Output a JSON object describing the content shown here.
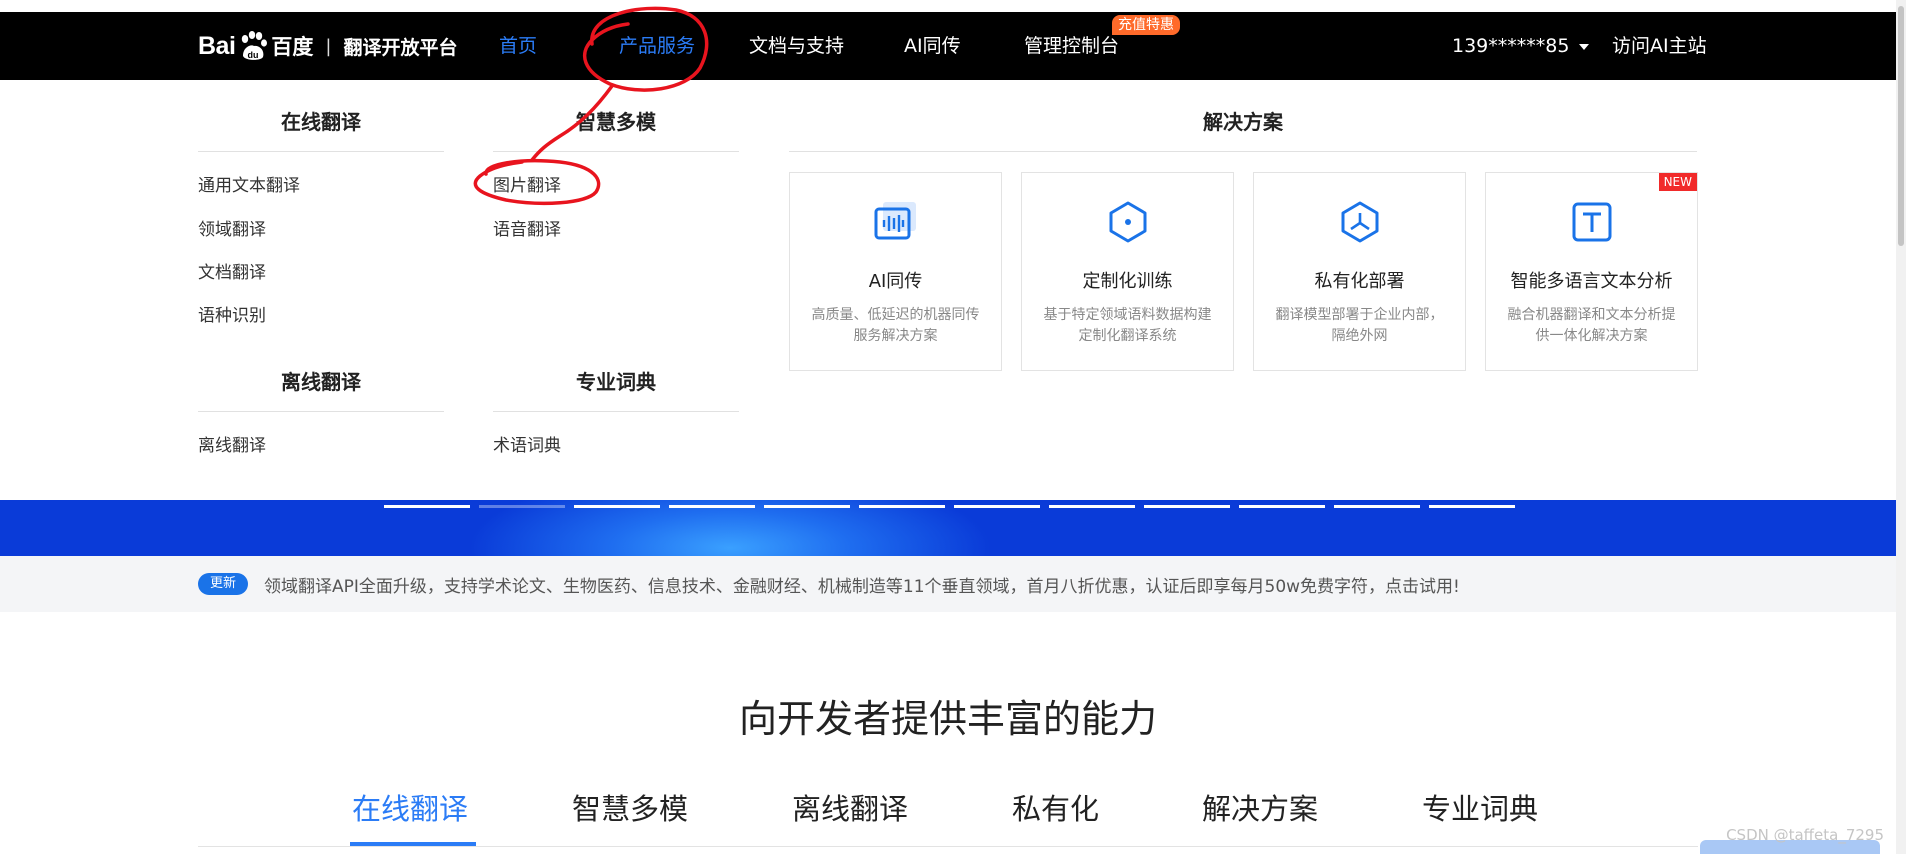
{
  "header": {
    "logo": {
      "bai": "Bai",
      "du": "百度",
      "separator": "|",
      "platform": "翻译开放平台"
    },
    "nav": {
      "home": "首页",
      "products": "产品服务",
      "docs": "文档与支持",
      "ai_simultaneous": "AI同传",
      "console": "管理控制台",
      "console_badge": "充值特惠",
      "account": "139******85",
      "visit_ai": "访问AI主站"
    }
  },
  "menu": {
    "online": {
      "heading": "在线翻译",
      "items": [
        "通用文本翻译",
        "领域翻译",
        "文档翻译",
        "语种识别"
      ]
    },
    "multimodal": {
      "heading": "智慧多模",
      "items": [
        "图片翻译",
        "语音翻译"
      ]
    },
    "offline": {
      "heading": "离线翻译",
      "items": [
        "离线翻译"
      ]
    },
    "dictionary": {
      "heading": "专业词典",
      "items": [
        "术语词典"
      ]
    },
    "solutions": {
      "heading": "解决方案",
      "cards": [
        {
          "icon": "waveform-icon",
          "title": "AI同传",
          "desc": "高质量、低延迟的机器同传服务解决方案"
        },
        {
          "icon": "hexagon-icon",
          "title": "定制化训练",
          "desc": "基于特定领域语料数据构建定制化翻译系统"
        },
        {
          "icon": "model-deploy-icon",
          "title": "私有化部署",
          "desc": "翻译模型部署于企业内部，隔绝外网"
        },
        {
          "icon": "text-analysis-icon",
          "title": "智能多语言文本分析",
          "desc": "融合机器翻译和文本分析提供一体化解决方案",
          "tag": "NEW"
        }
      ]
    }
  },
  "banner": {
    "slide_count": 12,
    "active_slide": 2
  },
  "update": {
    "pill": "更新",
    "text": "领域翻译API全面升级，支持学术论文、生物医药、信息技术、金融财经、机械制造等11个垂直领域，首月八折优惠，认证后即享每月50w免费字符，点击试用!"
  },
  "section": {
    "title": "向开发者提供丰富的能力",
    "tabs": [
      "在线翻译",
      "智慧多模",
      "离线翻译",
      "私有化",
      "解决方案",
      "专业词典"
    ],
    "active_tab": 0
  },
  "watermark": "CSDN @taffeta_7295",
  "colors": {
    "accent": "#2b7cf6",
    "badge": "#ff6a2a",
    "new_tag": "#f12a2a",
    "annotation": "#e8141e"
  }
}
